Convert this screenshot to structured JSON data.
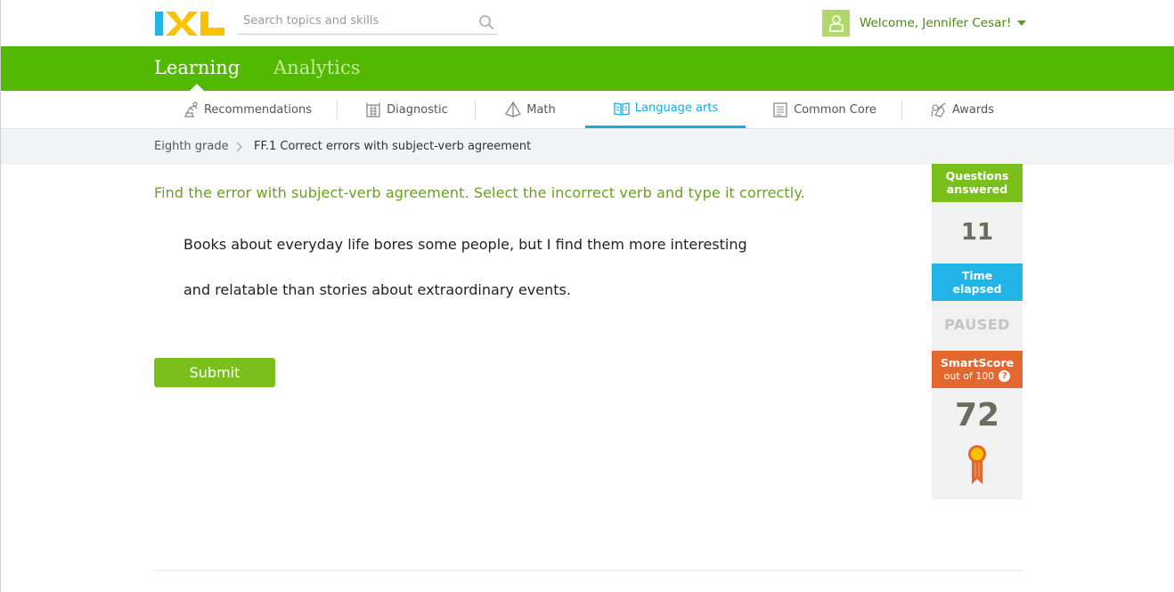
{
  "header": {
    "logo_alt": "IXL",
    "search_placeholder": "Search topics and skills",
    "welcome_text": "Welcome, Jennifer Cesar!"
  },
  "main_nav": {
    "tabs": [
      {
        "label": "Learning",
        "active": true
      },
      {
        "label": "Analytics",
        "active": false
      }
    ]
  },
  "sub_nav": {
    "items": [
      {
        "label": "Recommendations",
        "icon": "recommendations-icon"
      },
      {
        "label": "Diagnostic",
        "icon": "diagnostic-icon"
      },
      {
        "label": "Math",
        "icon": "math-icon"
      },
      {
        "label": "Language arts",
        "icon": "language-arts-icon",
        "active": true
      },
      {
        "label": "Common Core",
        "icon": "common-core-icon"
      },
      {
        "label": "Awards",
        "icon": "awards-icon"
      }
    ]
  },
  "breadcrumb": {
    "grade": "Eighth grade",
    "skill": "FF.1 Correct errors with subject-verb agreement"
  },
  "question": {
    "instructions": "Find the error with subject-verb agreement. Select the incorrect verb and type it correctly.",
    "line1": "Books about everyday life bores some people, but I find them more interesting",
    "line2": "and relatable than stories about extraordinary events.",
    "submit_label": "Submit"
  },
  "stats": {
    "questions_label_1": "Questions",
    "questions_label_2": "answered",
    "questions_value": "11",
    "time_label_1": "Time",
    "time_label_2": "elapsed",
    "time_value": "PAUSED",
    "smartscore_label": "SmartScore",
    "smartscore_sub": "out of 100",
    "smartscore_help": "?",
    "smartscore_value": "72"
  },
  "colors": {
    "brand_green": "#53b800",
    "instruction_green": "#6aa11c",
    "accent_blue": "#1fa8e0",
    "smartscore_orange": "#e2682f"
  }
}
